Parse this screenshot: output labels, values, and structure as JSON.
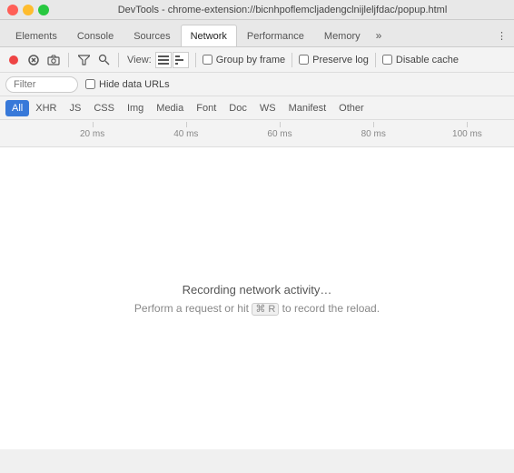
{
  "window": {
    "title": "DevTools - chrome-extension://bicnhpoflemcljadengclnijleljfdac/popup.html"
  },
  "titlebar_buttons": {
    "close": "close",
    "minimize": "minimize",
    "maximize": "maximize"
  },
  "tabs": [
    {
      "id": "elements",
      "label": "Elements",
      "active": false
    },
    {
      "id": "console",
      "label": "Console",
      "active": false
    },
    {
      "id": "sources",
      "label": "Sources",
      "active": false
    },
    {
      "id": "network",
      "label": "Network",
      "active": true
    },
    {
      "id": "performance",
      "label": "Performance",
      "active": false
    },
    {
      "id": "memory",
      "label": "Memory",
      "active": false
    }
  ],
  "toolbar": {
    "record_tooltip": "Record network log",
    "stop_tooltip": "Stop",
    "camera_tooltip": "Capture screenshots",
    "filter_tooltip": "Filter",
    "search_tooltip": "Search",
    "view_label": "View:",
    "view_list_tooltip": "Use large request rows",
    "view_waterfall_tooltip": "Show overview"
  },
  "options": {
    "group_by_frame_label": "Group by frame",
    "preserve_log_label": "Preserve log",
    "disable_cache_label": "Disable cache",
    "hide_data_urls_label": "Hide data URLs"
  },
  "filter": {
    "placeholder": "Filter"
  },
  "type_filters": [
    {
      "id": "all",
      "label": "All",
      "active": true
    },
    {
      "id": "xhr",
      "label": "XHR",
      "active": false
    },
    {
      "id": "js",
      "label": "JS",
      "active": false
    },
    {
      "id": "css",
      "label": "CSS",
      "active": false
    },
    {
      "id": "img",
      "label": "Img",
      "active": false
    },
    {
      "id": "media",
      "label": "Media",
      "active": false
    },
    {
      "id": "font",
      "label": "Font",
      "active": false
    },
    {
      "id": "doc",
      "label": "Doc",
      "active": false
    },
    {
      "id": "ws",
      "label": "WS",
      "active": false
    },
    {
      "id": "manifest",
      "label": "Manifest",
      "active": false
    },
    {
      "id": "other",
      "label": "Other",
      "active": false
    }
  ],
  "timeline": {
    "ticks": [
      "20 ms",
      "40 ms",
      "60 ms",
      "80 ms",
      "100 ms"
    ]
  },
  "main": {
    "recording_text": "Recording network activity…",
    "recording_subtext_before": "Perform a request or hit ",
    "recording_shortcut": "⌘ R",
    "recording_subtext_after": " to record the reload."
  }
}
